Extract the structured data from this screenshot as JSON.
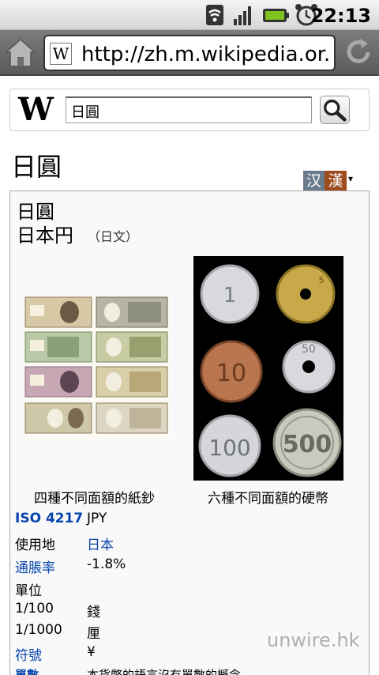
{
  "status_bar": {
    "time": "22:13",
    "icons": [
      "wifi-icon",
      "signal-icon",
      "battery-icon",
      "alarm-icon"
    ]
  },
  "browser": {
    "url": "http://zh.m.wikipedia.or...",
    "favicon": "W",
    "icons": [
      "home-icon",
      "reload-icon"
    ]
  },
  "wiki": {
    "logo": "W",
    "search_value": "日圓",
    "search_icon": "magnifier-icon"
  },
  "page": {
    "title": "日圓",
    "variant_han": "汉",
    "variant_trad": "漢",
    "variant_caret": "▾",
    "variant_up": "▲"
  },
  "infobox": {
    "name_line1": "日圓",
    "name_line2": "日本円",
    "lang_note": "（日文）",
    "caption_banknotes": "四種不同面額的紙鈔",
    "caption_coins": "六種不同面額的硬幣",
    "coin_labels": [
      "1",
      "5",
      "10",
      "50",
      "100",
      "500"
    ],
    "rows": [
      {
        "key": "ISO 4217",
        "value": "JPY"
      },
      {
        "key": "使用地",
        "value": "日本"
      },
      {
        "key": "通脹率",
        "value": "-1.8%"
      },
      {
        "key": "單位",
        "value": ""
      },
      {
        "key": "1/100",
        "value": "錢"
      },
      {
        "key": "1/1000",
        "value": "厘"
      },
      {
        "key": "符號",
        "value": "¥"
      },
      {
        "key": "單數",
        "value": "本貨幣的語言沒有單數的概念"
      }
    ]
  },
  "watermark": "unwire.hk",
  "colors": {
    "link": "#0645ad",
    "variant_han": "#6b7b8e",
    "variant_trad": "#9e4c1d"
  }
}
